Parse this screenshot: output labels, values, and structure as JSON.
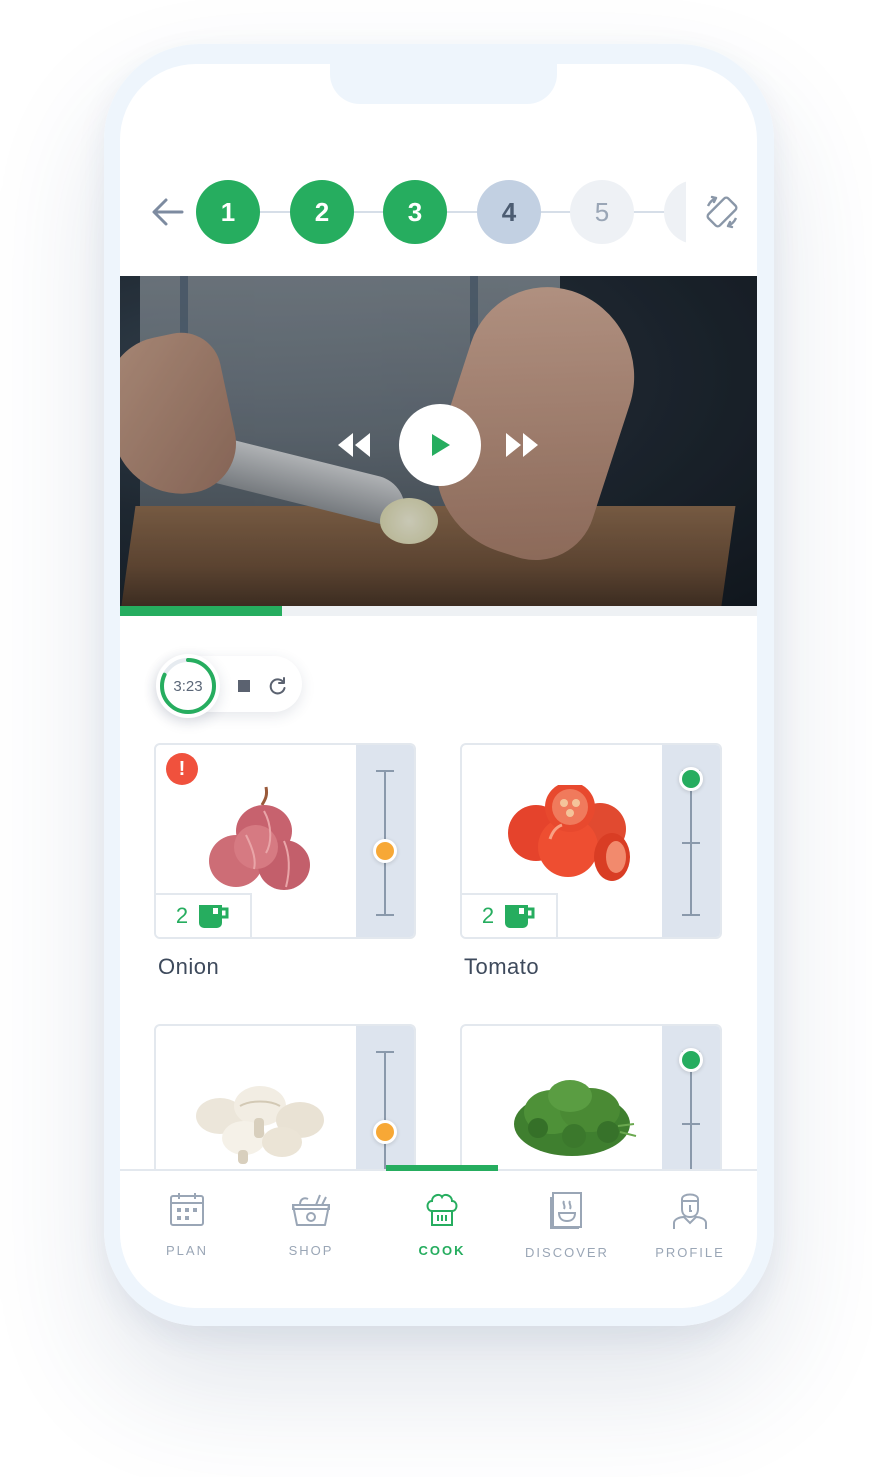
{
  "steps": {
    "items": [
      {
        "label": "1",
        "state": "done"
      },
      {
        "label": "2",
        "state": "done"
      },
      {
        "label": "3",
        "state": "done"
      },
      {
        "label": "4",
        "state": "current"
      },
      {
        "label": "5",
        "state": "todo"
      }
    ]
  },
  "video": {
    "progress_fraction": 0.255
  },
  "timer": {
    "time": "3:23",
    "ring_fraction": 0.82
  },
  "ingredients": [
    {
      "name": "Onion",
      "quantity": "2",
      "unit_icon": "cup-icon",
      "alert": "!",
      "level": 0.5,
      "knob_color": "#f7a836"
    },
    {
      "name": "Tomato",
      "quantity": "2",
      "unit_icon": "cup-icon",
      "level": 1.0,
      "knob_color": "#26ad5f"
    },
    {
      "name": "",
      "level": 0.5,
      "knob_color": "#f7a836"
    },
    {
      "name": "",
      "level": 1.0,
      "knob_color": "#26ad5f"
    }
  ],
  "tabs": [
    {
      "label": "PLAN",
      "icon": "calendar-icon",
      "active": false
    },
    {
      "label": "SHOP",
      "icon": "basket-icon",
      "active": false
    },
    {
      "label": "COOK",
      "icon": "chef-hat-icon",
      "active": true
    },
    {
      "label": "DISCOVER",
      "icon": "recipe-book-icon",
      "active": false
    },
    {
      "label": "PROFILE",
      "icon": "user-icon",
      "active": false
    }
  ],
  "colors": {
    "accent": "#26ad5f",
    "current_step": "#c2d0e2",
    "alert": "#f0513d",
    "warning_knob": "#f7a836"
  }
}
